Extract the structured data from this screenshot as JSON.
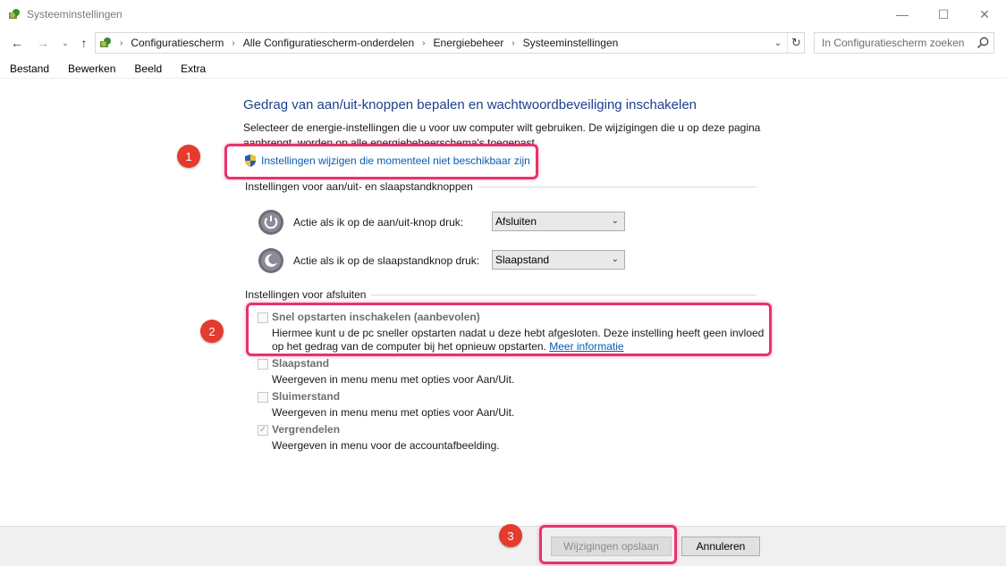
{
  "window": {
    "title": "Systeeminstellingen",
    "minimize": "—",
    "maximize": "☐",
    "close": "✕"
  },
  "nav": {
    "back": "←",
    "forward": "→",
    "recent": "⌄",
    "up": "↑",
    "breadcrumbs": [
      "Configuratiescherm",
      "Alle Configuratiescherm-onderdelen",
      "Energiebeheer",
      "Systeeminstellingen"
    ],
    "separator": "›",
    "dropdown": "⌄",
    "refresh": "↻",
    "search_placeholder": "In Configuratiescherm zoeken"
  },
  "menu": [
    "Bestand",
    "Bewerken",
    "Beeld",
    "Extra"
  ],
  "main": {
    "heading": "Gedrag van aan/uit-knoppen bepalen en wachtwoordbeveiliging inschakelen",
    "description": "Selecteer de energie-instellingen die u voor uw computer wilt gebruiken. De wijzigingen die u op deze pagina aanbrengt, worden op alle energiebeheerschema's toegepast.",
    "admin_link": "Instellingen wijzigen die momenteel niet beschikbaar zijn",
    "power_group_title": "Instellingen voor aan/uit- en slaapstandknoppen",
    "power_button": {
      "label": "Actie als ik op de aan/uit-knop druk:",
      "value": "Afsluiten"
    },
    "sleep_button": {
      "label": "Actie als ik op de slaapstandknop druk:",
      "value": "Slaapstand"
    },
    "shutdown_group_title": "Instellingen voor afsluiten",
    "options": [
      {
        "title": "Snel opstarten inschakelen (aanbevolen)",
        "desc1": "Hiermee kunt u de pc sneller opstarten nadat u deze hebt afgesloten. Deze instelling heeft geen invloed",
        "desc2": "op het gedrag van de computer bij het opnieuw opstarten.",
        "more": "Meer informatie",
        "checked": false
      },
      {
        "title": "Slaapstand",
        "desc1": "Weergeven in menu menu met opties voor Aan/Uit.",
        "checked": false
      },
      {
        "title": "Sluimerstand",
        "desc1": "Weergeven in menu menu met opties voor Aan/Uit.",
        "checked": false
      },
      {
        "title": "Vergrendelen",
        "desc1": "Weergeven in menu voor de accountafbeelding.",
        "checked": true
      }
    ]
  },
  "buttons": {
    "save": "Wijzigingen opslaan",
    "cancel": "Annuleren"
  },
  "annotations": [
    "1",
    "2",
    "3"
  ],
  "colors": {
    "heading": "#1e3f8a",
    "link": "#0a5bb3",
    "callout": "#e8336a",
    "badge": "#e53b2f"
  },
  "glyphs": {
    "chevron": "⌄",
    "check": "✓"
  }
}
